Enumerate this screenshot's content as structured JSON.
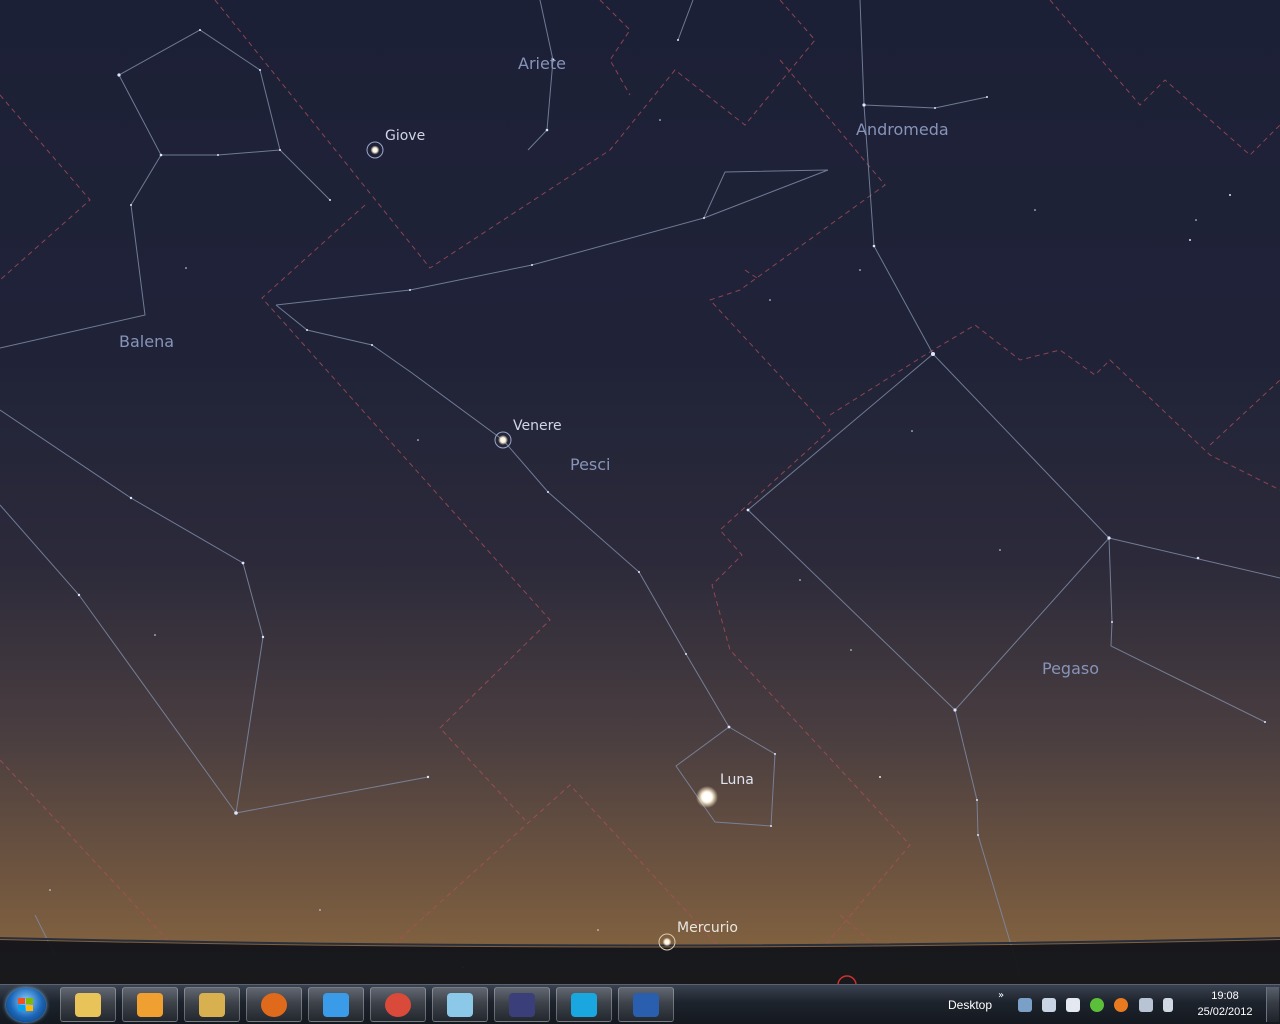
{
  "sky": {
    "constellations": [
      "Ariete",
      "Andromeda",
      "Balena",
      "Pesci",
      "Pegaso"
    ],
    "planets": [
      "Giove",
      "Venere",
      "Luna",
      "Mercurio"
    ]
  },
  "taskbar": {
    "apps": [
      {
        "name": "explorer-icon",
        "color": "#e8c35a"
      },
      {
        "name": "media-player-icon",
        "color": "#f0a030"
      },
      {
        "name": "file-manager-icon",
        "color": "#d8b050"
      },
      {
        "name": "firefox-icon",
        "color": "#e06a1c"
      },
      {
        "name": "internet-explorer-icon",
        "color": "#3a9be8"
      },
      {
        "name": "chrome-icon",
        "color": "#d94a3a"
      },
      {
        "name": "notepad-icon",
        "color": "#8cc8e8"
      },
      {
        "name": "stellarium-icon",
        "color": "#3a3f7a"
      },
      {
        "name": "skype-icon",
        "color": "#1aa7e0"
      },
      {
        "name": "word-icon",
        "color": "#2a5fb0"
      }
    ],
    "desktop_label": "Desktop",
    "overflow": "»",
    "clock_time": "19:08",
    "clock_date": "25/02/2012"
  }
}
